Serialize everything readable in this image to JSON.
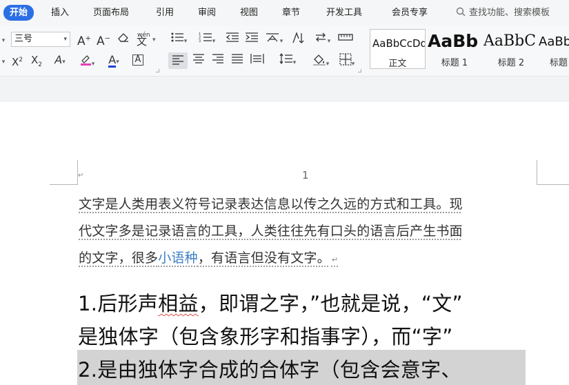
{
  "menubar": {
    "tabs": [
      {
        "label": "开始",
        "active": true
      },
      {
        "label": "插入"
      },
      {
        "label": "页面布局"
      },
      {
        "label": "引用"
      },
      {
        "label": "审阅"
      },
      {
        "label": "视图"
      },
      {
        "label": "章节"
      },
      {
        "label": "开发工具"
      },
      {
        "label": "会员专享"
      }
    ],
    "search_icon": "search-icon",
    "search_label": "查找功能、搜索模板"
  },
  "ribbon": {
    "font_size": "三号",
    "font_row1": {
      "grow_font": "A⁺",
      "shrink_font": "A⁻",
      "eraser": "⌫",
      "pinyin": "wén"
    },
    "font_row2": {
      "superscript": "X²",
      "subscript": "X₂",
      "text_effect": "A",
      "highlight": "✎",
      "font_color": "A",
      "char_border": "A"
    },
    "accent_colors": {
      "highlight": "#e83fb8",
      "font_color": "#1f3fd6",
      "active_tab": "#2b6fe5"
    },
    "styles": [
      {
        "preview": "AaBbCcDd",
        "name": "正文"
      },
      {
        "preview": "AaBb",
        "name": "标题 1"
      },
      {
        "preview": "AaBbC",
        "name": "标题 2"
      },
      {
        "preview": "AaBb",
        "name": "标题"
      }
    ]
  },
  "document": {
    "page_number": "1",
    "para_mark": "↵",
    "paragraph1": {
      "line1": "文字是人类用表义符号记录表达信息以传之久远的方式和工具。现",
      "line2": "代文字多是记录语言的工具，人类往往先有口头的语言后产生书面",
      "line3_before": "的文字，很多",
      "line3_link": "小语种",
      "line3_after": "，有语言但没有文字。"
    },
    "paragraph2": {
      "line1_a": "1.后形声",
      "line1_b": "相益",
      "line1_c": "，即谓之字，”也就是说，“文”",
      "line2": "是独体字（包含象形字和指事字），而“字”",
      "line3": "2.是由独体字合成的合体字（包含会意字、"
    }
  }
}
